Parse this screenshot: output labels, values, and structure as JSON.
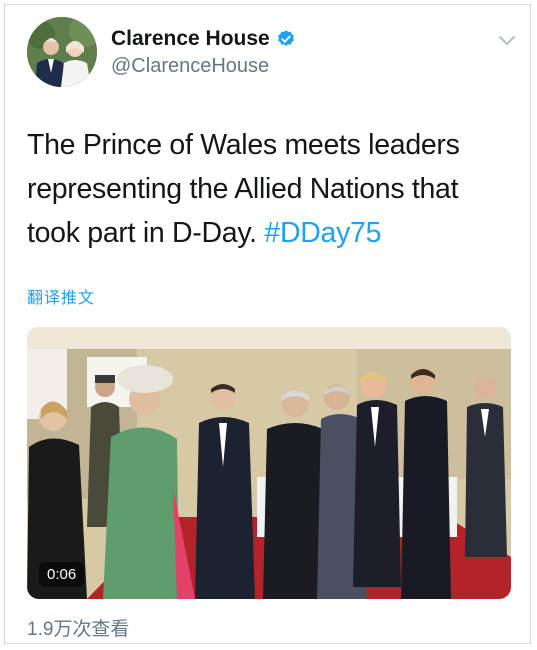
{
  "account": {
    "display_name": "Clarence House",
    "handle": "@ClarenceHouse",
    "verified": true
  },
  "tweet": {
    "text": "The Prince of Wales meets leaders representing the Allied Nations that took part in D-Day.",
    "hashtag": "#DDay75",
    "translate_label": "翻译推文"
  },
  "media": {
    "type": "video",
    "duration": "0:06"
  },
  "stats": {
    "views": "1.9万次查看"
  },
  "colors": {
    "link": "#1da1f2",
    "secondary_text": "#657786",
    "verified_badge": "#1da1f2"
  },
  "icons": [
    "verified-badge-icon",
    "chevron-down-icon"
  ]
}
